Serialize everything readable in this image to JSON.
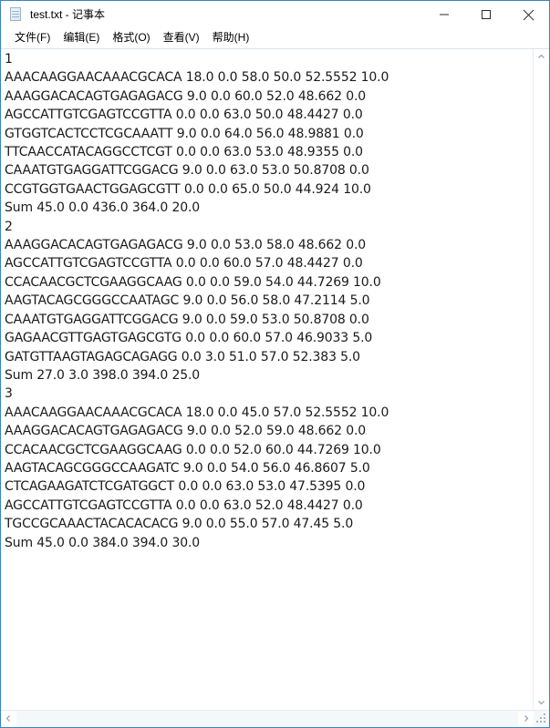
{
  "window": {
    "title": "test.txt - 记事本",
    "icon": "notepad-document-icon",
    "controls": {
      "minimize": "最小化",
      "maximize": "最大化",
      "close": "关闭"
    }
  },
  "menubar": {
    "items": [
      {
        "label": "文件(F)",
        "name": "menu-file"
      },
      {
        "label": "编辑(E)",
        "name": "menu-edit"
      },
      {
        "label": "格式(O)",
        "name": "menu-format"
      },
      {
        "label": "查看(V)",
        "name": "menu-view"
      },
      {
        "label": "帮助(H)",
        "name": "menu-help"
      }
    ]
  },
  "document": {
    "filename": "test.txt",
    "lines": [
      "1",
      "AAACAAGGAACAAACGCACA 18.0 0.0 58.0 50.0 52.5552 10.0",
      "AAAGGACACAGTGAGAGACG 9.0 0.0 60.0 52.0 48.662 0.0",
      "AGCCATTGTCGAGTCCGTTA 0.0 0.0 63.0 50.0 48.4427 0.0",
      "GTGGTCACTCCTCGCAAATT 9.0 0.0 64.0 56.0 48.9881 0.0",
      "TTCAACCATACAGGCCTCGT 0.0 0.0 63.0 53.0 48.9355 0.0",
      "CAAATGTGAGGATTCGGACG 9.0 0.0 63.0 53.0 50.8708 0.0",
      "CCGTGGTGAACTGGAGCGTT 0.0 0.0 65.0 50.0 44.924 10.0",
      "Sum 45.0 0.0 436.0 364.0 20.0",
      "2",
      "AAAGGACACAGTGAGAGACG 9.0 0.0 53.0 58.0 48.662 0.0",
      "AGCCATTGTCGAGTCCGTTA 0.0 0.0 60.0 57.0 48.4427 0.0",
      "CCACAACGCTCGAAGGCAAG 0.0 0.0 59.0 54.0 44.7269 10.0",
      "AAGTACAGCGGGCCAATAGC 9.0 0.0 56.0 58.0 47.2114 5.0",
      "CAAATGTGAGGATTCGGACG 9.0 0.0 59.0 53.0 50.8708 0.0",
      "GAGAACGTTGAGTGAGCGTG 0.0 0.0 60.0 57.0 46.9033 5.0",
      "GATGTTAAGTAGAGCAGAGG 0.0 3.0 51.0 57.0 52.383 5.0",
      "Sum 27.0 3.0 398.0 394.0 25.0",
      "3",
      "AAACAAGGAACAAACGCACA 18.0 0.0 45.0 57.0 52.5552 10.0",
      "AAAGGACACAGTGAGAGACG 9.0 0.0 52.0 59.0 48.662 0.0",
      "CCACAACGCTCGAAGGCAAG 0.0 0.0 52.0 60.0 44.7269 10.0",
      "AAGTACAGCGGGCCAAGATC 9.0 0.0 54.0 56.0 46.8607 5.0",
      "CTCAGAAGATCTCGATGGCT 0.0 0.0 63.0 53.0 47.5395 0.0",
      "AGCCATTGTCGAGTCCGTTA 0.0 0.0 63.0 52.0 48.4427 0.0",
      "TGCCGCAAACTACACACACG 9.0 0.0 55.0 57.0 47.45 5.0",
      "Sum 45.0 0.0 384.0 394.0 30.0"
    ]
  },
  "scrollbars": {
    "vertical": {
      "up_arrow": "▲",
      "down_arrow": "▼"
    },
    "horizontal": {
      "left_arrow": "◀",
      "right_arrow": "▶"
    }
  },
  "colors": {
    "window_border": "#3a84c3",
    "text": "#1a1a1a",
    "background": "#ffffff",
    "scrollbar_track": "#f4f8fb"
  }
}
